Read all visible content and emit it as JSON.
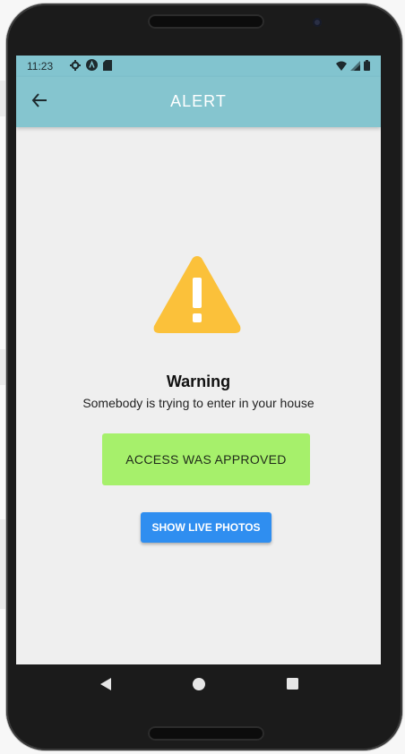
{
  "status_bar": {
    "time": "11:23",
    "icons_left": [
      "gear-icon",
      "app-icon",
      "sd-card-icon"
    ],
    "icons_right": [
      "wifi-icon",
      "signal-icon",
      "battery-icon"
    ]
  },
  "app_bar": {
    "title": "ALERT",
    "back_icon": "arrow-back-icon",
    "background": "#85c5cf"
  },
  "alert": {
    "icon": "warning-icon",
    "icon_color": "#fbc13a",
    "title": "Warning",
    "message": "Somebody is trying to enter in your house",
    "status_text": "ACCESS WAS APPROVED",
    "status_color": "#a6f06b"
  },
  "actions": {
    "show_live_photos_label": "SHOW LIVE PHOTOS",
    "button_color": "#2f8ef0"
  },
  "nav_bar": {
    "buttons": [
      "back-triangle-icon",
      "home-circle-icon",
      "recents-square-icon"
    ]
  }
}
